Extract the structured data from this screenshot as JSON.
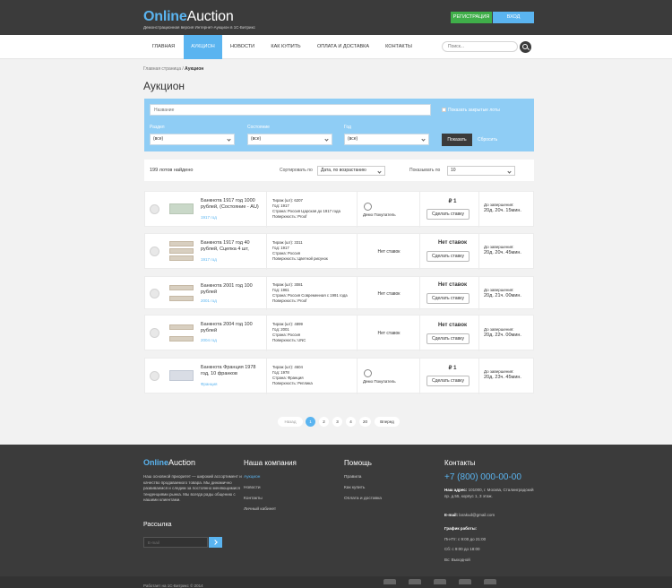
{
  "header": {
    "logo_a": "Online",
    "logo_b": "Auction",
    "subtitle": "Демонстрационная версия Интернет-Аукцион в 1С-Битрикс",
    "register": "РЕГИСТРАЦИЯ",
    "login": "ВХОД"
  },
  "nav": {
    "items": [
      "ГЛАВНАЯ",
      "АУКЦИОН",
      "НОВОСТИ",
      "КАК КУПИТЬ",
      "ОПЛАТА И ДОСТАВКА",
      "КОНТАКТЫ"
    ],
    "search_placeholder": "Поиск..."
  },
  "breadcrumb": {
    "home": "Главная страница",
    "sep": "/",
    "current": "Аукцион"
  },
  "page_title": "Аукцион",
  "filter": {
    "name_placeholder": "Название",
    "show_closed": "Показать закрытые лоты",
    "section_label": "Раздел",
    "state_label": "Состояние",
    "year_label": "Год",
    "any": "(все)",
    "show": "Показать",
    "reset": "Сбросить"
  },
  "results": {
    "count": "199 лотов найдено",
    "sort_label": "Сортировать по",
    "sort_value": "Дата, по возрастанию",
    "per_page_label": "Показывать по",
    "per_page_value": "10"
  },
  "lots": [
    {
      "title": "Банкнота 1917 год 1000 рублей, (Состояние - AU)",
      "sub": "1917 год",
      "circulation": "Тираж (шт): 6207",
      "year": "Год: 1917",
      "country": "Страна: Россия Царская до 1917 года",
      "surface": "Поверхность: Proof",
      "bid_status": "",
      "bidder": "Демо Покупатель",
      "price": "₽ 1",
      "bid_button": "Сделать ставку",
      "end_label": "До завершения:",
      "end_time": "20д. 20ч. 15мин."
    },
    {
      "title": "Банкнота 1917 год 40 рублей, Сцепка 4 шт,",
      "sub": "1917 год",
      "circulation": "Тираж (шт): 3311",
      "year": "Год: 1917",
      "country": "Страна: Россия",
      "surface": "Поверхность: Цветной рисунок",
      "bid_status": "Нет ставок",
      "bidder": "",
      "price": "Нет ставок",
      "bid_button": "Сделать ставку",
      "end_label": "До завершения:",
      "end_time": "20д. 20ч. 45мин."
    },
    {
      "title": "Банкнота 2001 год 100 рублей",
      "sub": "2001 год",
      "circulation": "Тираж (шт): 3081",
      "year": "Год: 1961",
      "country": "Страна: Россия Современная с 1991 года",
      "surface": "Поверхность: Proof",
      "bid_status": "Нет ставок",
      "bidder": "",
      "price": "Нет ставок",
      "bid_button": "Сделать ставку",
      "end_label": "До завершения:",
      "end_time": "20д. 21ч. 00мин."
    },
    {
      "title": "Банкнота 2004 год 100 рублей",
      "sub": "2004 год",
      "circulation": "Тираж (шт): 4899",
      "year": "Год: 2001",
      "country": "Страна: Россия",
      "surface": "Поверхность: UNC",
      "bid_status": "Нет ставок",
      "bidder": "",
      "price": "Нет ставок",
      "bid_button": "Сделать ставку",
      "end_label": "До завершения:",
      "end_time": "20д. 22ч. 00мин."
    },
    {
      "title": "Банкнота Франция 1978 год, 10 франков",
      "sub": "Франция",
      "circulation": "Тираж (шт): 4604",
      "year": "Год: 1978",
      "country": "Страна: Франция",
      "surface": "Поверхность: Реплика",
      "bid_status": "",
      "bidder": "Демо Покупатель",
      "price": "₽ 1",
      "bid_button": "Сделать ставку",
      "end_label": "До завершения:",
      "end_time": "20д. 23ч. 45мин."
    }
  ],
  "pagination": {
    "prev": "Назад",
    "pages": [
      "1",
      "2",
      "3",
      "4",
      "20"
    ],
    "next": "Вперед"
  },
  "footer": {
    "logo_a": "Online",
    "logo_b": "Auction",
    "about": "Наш основной приоритет — широкий ассортимент и качество продаваемого товара. Мы динамично развиваемся и следим за постоянно меняющимися тенденциями рынка. Мы всегда рады общению с нашими клиентами.",
    "newsletter": "Рассылка",
    "email_placeholder": "E-mail",
    "company_title": "Наша компания",
    "company_links": [
      "Аукцион",
      "Новости",
      "Контакты",
      "Личный кабинет"
    ],
    "help_title": "Помощь",
    "help_links": [
      "Правила",
      "Как купить",
      "Оплата и доставка"
    ],
    "contacts_title": "Контакты",
    "phone": "+7 (800) 000-00-00",
    "address_label": "Наш адрес:",
    "address": "101000, г. Москва, Сталинградский пр. д.55, корпус 1, 3 этаж.",
    "email_label": "E-mail:",
    "email": "larakud@gmail.com",
    "hours_label": "График работы:",
    "hours": [
      "Пн-Пт: с 9:00 до 21:00",
      "Сб: с 9:00 до 18:00",
      "Вс: Выходной"
    ],
    "powered": "Работает на 1С-Битрикс © 2014"
  }
}
